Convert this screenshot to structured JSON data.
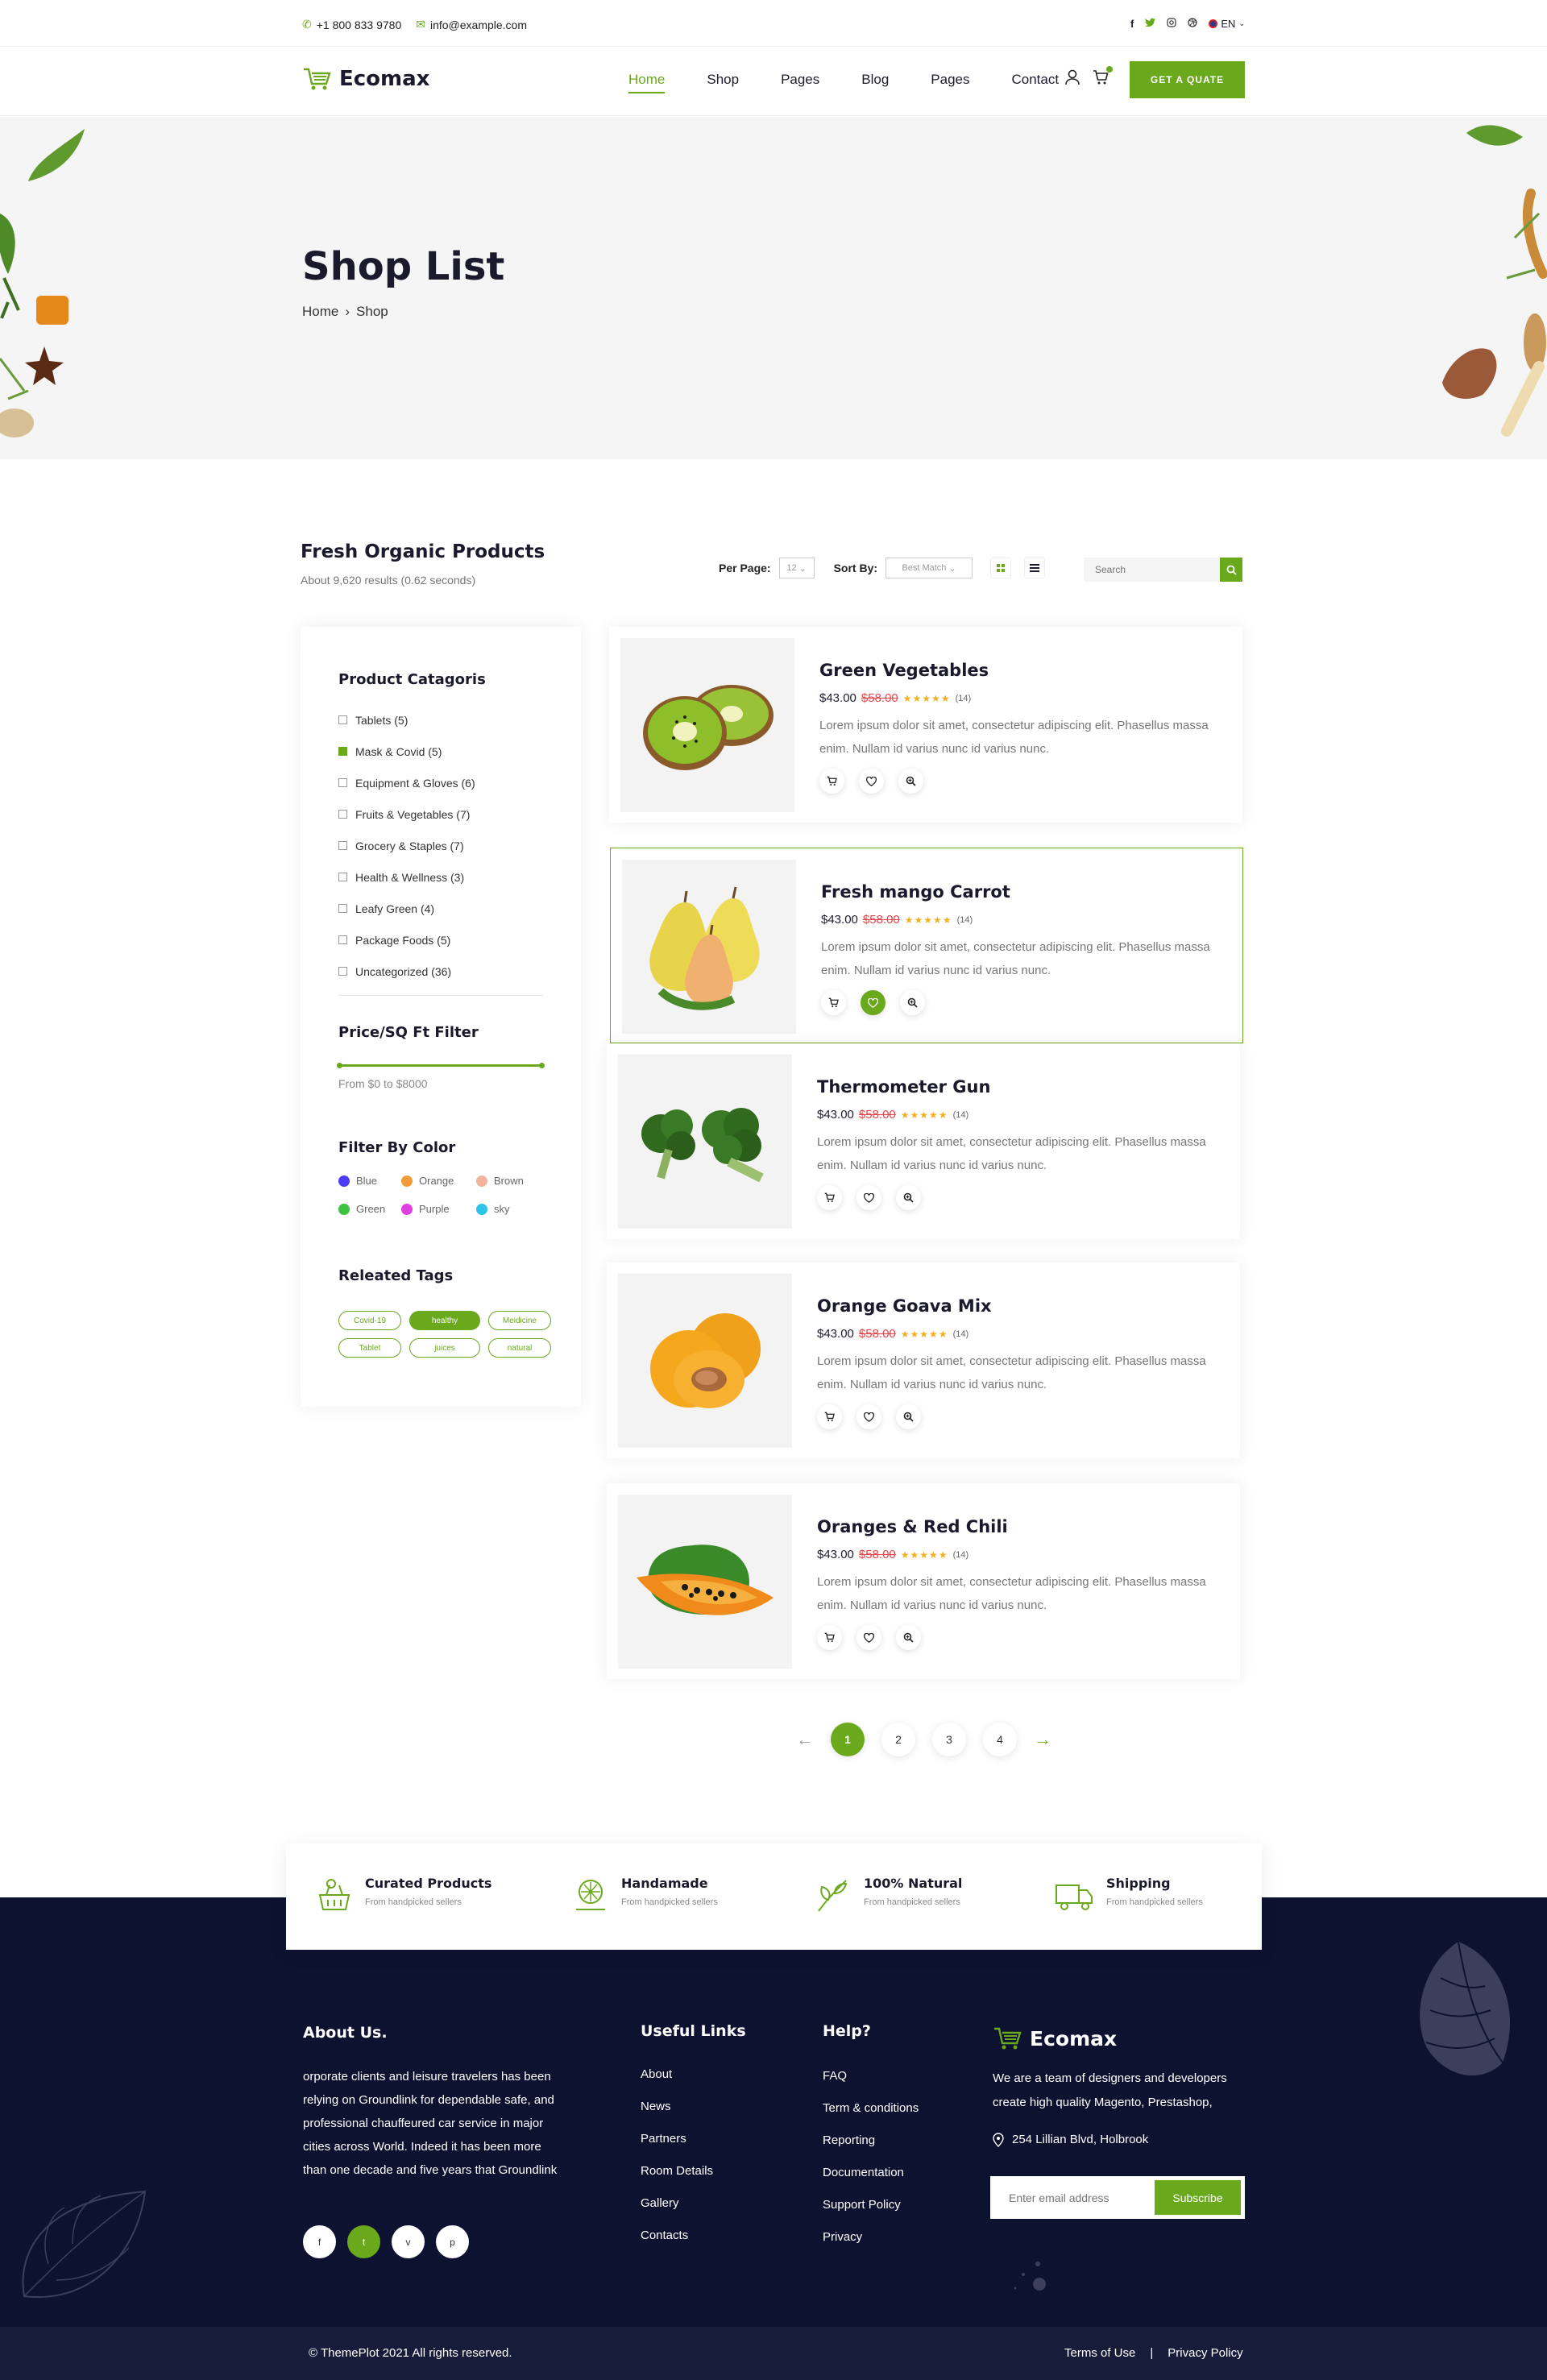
{
  "topbar": {
    "phone": "+1 800 833 9780",
    "email": "info@example.com",
    "language": "EN",
    "social_icons": [
      "facebook-icon",
      "twitter-icon",
      "instagram-icon",
      "dribbble-icon"
    ]
  },
  "nav": {
    "logo_text": "Ecomax",
    "menu": [
      "Home",
      "Shop",
      "Pages",
      "Blog",
      "Pages",
      "Contact"
    ],
    "active_menu": "Home",
    "quote_button": "GET A QUATE"
  },
  "hero": {
    "title": "Shop List",
    "breadcrumb": [
      "Home",
      "Shop"
    ]
  },
  "listing": {
    "title": "Fresh Organic Products",
    "results": "About 9,620 results (0.62 seconds)",
    "per_page_label": "Per Page:",
    "per_page_value": "12",
    "sort_label": "Sort By:",
    "sort_value": "Best Match",
    "search_placeholder": "Search"
  },
  "sidebar": {
    "categories_title": "Product Catagoris",
    "categories": [
      {
        "label": "Tablets (5)",
        "checked": false
      },
      {
        "label": "Mask & Covid (5)",
        "checked": true
      },
      {
        "label": "Equipment & Gloves (6)",
        "checked": false
      },
      {
        "label": "Fruits & Vegetables (7)",
        "checked": false
      },
      {
        "label": "Grocery & Staples (7)",
        "checked": false
      },
      {
        "label": "Health & Wellness (3)",
        "checked": false
      },
      {
        "label": "Leafy Green (4)",
        "checked": false
      },
      {
        "label": "Package Foods (5)",
        "checked": false
      },
      {
        "label": "Uncategorized (36)",
        "checked": false
      }
    ],
    "price_title": "Price/SQ Ft Filter",
    "price_range": "From $0 to $8000",
    "color_title": "Filter By Color",
    "colors": [
      {
        "label": "Blue",
        "hex": "#4b3df5"
      },
      {
        "label": "Orange",
        "hex": "#f29b3a"
      },
      {
        "label": "Brown",
        "hex": "#f2b49a"
      },
      {
        "label": "Green",
        "hex": "#3fc23f"
      },
      {
        "label": "Purple",
        "hex": "#e03ee0"
      },
      {
        "label": "sky",
        "hex": "#2ec4e8"
      }
    ],
    "tags_title": "Releated Tags",
    "tags": [
      {
        "label": "Covid-19",
        "active": false
      },
      {
        "label": "healthy",
        "active": true
      },
      {
        "label": "Meidicine",
        "active": false
      },
      {
        "label": "Tablet",
        "active": false
      },
      {
        "label": "juices",
        "active": false
      },
      {
        "label": "natural",
        "active": false
      }
    ]
  },
  "products": [
    {
      "name": "Green Vegetables",
      "price": "$43.00",
      "old_price": "$58.00",
      "stars": "★★★★★",
      "reviews": "(14)",
      "desc": "Lorem ipsum dolor sit amet, consectetur adipiscing elit. Phasellus massa enim. Nullam id varius nunc id varius nunc.",
      "fruit": "kiwi"
    },
    {
      "name": "Fresh mango Carrot",
      "price": "$43.00",
      "old_price": "$58.00",
      "stars": "★★★★★",
      "reviews": "(14)",
      "desc": "Lorem ipsum dolor sit amet, consectetur adipiscing elit. Phasellus massa enim. Nullam id varius nunc id varius nunc.",
      "fruit": "pear"
    },
    {
      "name": "Thermometer Gun",
      "price": "$43.00",
      "old_price": "$58.00",
      "stars": "★★★★★",
      "reviews": "(14)",
      "desc": "Lorem ipsum dolor sit amet, consectetur adipiscing elit. Phasellus massa enim. Nullam id varius nunc id varius nunc.",
      "fruit": "broccoli"
    },
    {
      "name": "Orange Goava Mix",
      "price": "$43.00",
      "old_price": "$58.00",
      "stars": "★★★★★",
      "reviews": "(14)",
      "desc": "Lorem ipsum dolor sit amet, consectetur adipiscing elit. Phasellus massa enim. Nullam id varius nunc id varius nunc.",
      "fruit": "apricot"
    },
    {
      "name": "Oranges & Red Chili",
      "price": "$43.00",
      "old_price": "$58.00",
      "stars": "★★★★★",
      "reviews": "(14)",
      "desc": "Lorem ipsum dolor sit amet, consectetur adipiscing elit. Phasellus massa enim. Nullam id varius nunc id varius nunc.",
      "fruit": "papaya"
    }
  ],
  "pagination": {
    "pages": [
      "1",
      "2",
      "3",
      "4"
    ],
    "current": "1"
  },
  "features": [
    {
      "title": "Curated Products",
      "sub": "From handpicked sellers"
    },
    {
      "title": "Handamade",
      "sub": "From handpicked sellers"
    },
    {
      "title": "100% Natural",
      "sub": "From handpicked sellers"
    },
    {
      "title": "Shipping",
      "sub": "From handpicked sellers"
    }
  ],
  "footer": {
    "about_title": "About Us.",
    "about_text": "orporate clients and leisure travelers has been relying on Groundlink for dependable safe, and professional chauffeured car service in major cities across World. Indeed it has been more than one decade and five years that Groundlink",
    "social": [
      "f",
      "t",
      "v",
      "p"
    ],
    "useful_title": "Useful Links",
    "useful_links": [
      "About",
      "News",
      "Partners",
      "Room Details",
      "Gallery",
      "Contacts"
    ],
    "help_title": "Help?",
    "help_links": [
      "FAQ",
      "Term & conditions",
      "Reporting",
      "Documentation",
      "Support Policy",
      "Privacy"
    ],
    "logo_text": "Ecomax",
    "desc": "We are a team of designers and developers create high quality Magento, Prestashop,",
    "address": "254 Lillian Blvd, Holbrook",
    "email_placeholder": "Enter email address",
    "subscribe": "Subscribe",
    "copyright": "© ThemePlot 2021 All rights reserved.",
    "terms": "Terms of Use",
    "sep": "|",
    "privacy": "Privacy Policy"
  },
  "colors": {
    "accent": "#6aa81c",
    "footer_bg": "#0d1231"
  }
}
